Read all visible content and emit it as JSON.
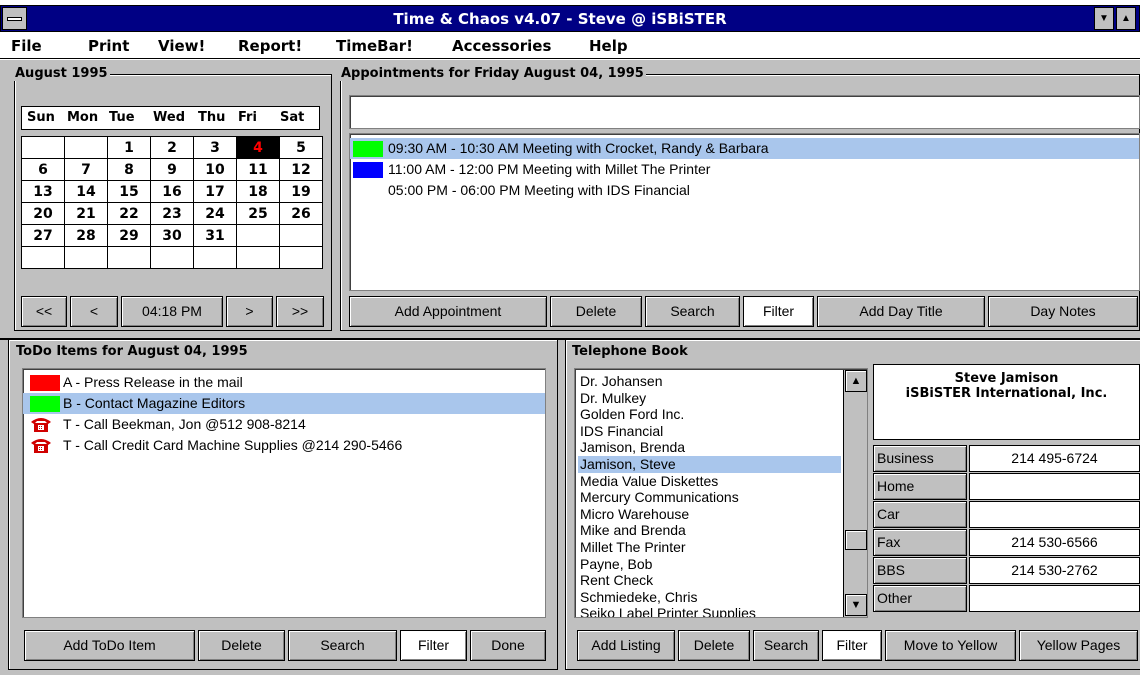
{
  "window": {
    "title": "Time & Chaos v4.07 - Steve @ iSBiSTER"
  },
  "menu": [
    "File",
    "Print",
    "View!",
    "Report!",
    "TimeBar!",
    "Accessories",
    "Help"
  ],
  "calendar": {
    "title": "August 1995",
    "days": [
      "Sun",
      "Mon",
      "Tue",
      "Wed",
      "Thu",
      "Fri",
      "Sat"
    ],
    "weeks": [
      [
        "",
        "",
        "1",
        "2",
        "3",
        "4",
        "5"
      ],
      [
        "6",
        "7",
        "8",
        "9",
        "10",
        "11",
        "12"
      ],
      [
        "13",
        "14",
        "15",
        "16",
        "17",
        "18",
        "19"
      ],
      [
        "20",
        "21",
        "22",
        "23",
        "24",
        "25",
        "26"
      ],
      [
        "27",
        "28",
        "29",
        "30",
        "31",
        "",
        ""
      ],
      [
        "",
        "",
        "",
        "",
        "",
        "",
        ""
      ]
    ],
    "selected_day": "4",
    "nav": {
      "first": "<<",
      "prev": "<",
      "time": "04:18 PM",
      "next": ">",
      "last": ">>"
    }
  },
  "appointments": {
    "title": "Appointments for Friday August 04, 1995",
    "day_title": "",
    "items": [
      {
        "text": "09:30 AM - 10:30 AM Meeting with Crocket, Randy & Barbara",
        "color": "#00ff00",
        "selected": true
      },
      {
        "text": "11:00 AM - 12:00 PM Meeting with Millet The Printer",
        "color": "#0000ff",
        "selected": false
      },
      {
        "text": "05:00 PM - 06:00 PM Meeting with IDS Financial",
        "color": "",
        "selected": false
      }
    ],
    "buttons": {
      "add": "Add Appointment",
      "delete": "Delete",
      "search": "Search",
      "filter": "Filter",
      "day_title": "Add Day Title",
      "day_notes": "Day Notes"
    }
  },
  "todo": {
    "title": "ToDo Items for August 04, 1995",
    "items": [
      {
        "text": "A - Press Release in the mail",
        "icon": "red-swatch",
        "color": "#ff0000"
      },
      {
        "text": "B - Contact Magazine Editors",
        "icon": "green-swatch",
        "color": "#00ff00",
        "selected": true
      },
      {
        "text": "T - Call Beekman, Jon @512 908-8214",
        "icon": "telephone-icon"
      },
      {
        "text": "T - Call Credit Card Machine Supplies @214 290-5466",
        "icon": "telephone-icon"
      }
    ],
    "buttons": {
      "add": "Add ToDo Item",
      "delete": "Delete",
      "search": "Search",
      "filter": "Filter",
      "done": "Done"
    }
  },
  "phonebook": {
    "title": "Telephone Book",
    "entries": [
      "Dr. Johansen",
      "Dr. Mulkey",
      "Golden Ford Inc.",
      "IDS Financial",
      "Jamison, Brenda",
      "Jamison, Steve",
      "Media Value Diskettes",
      "Mercury Communications",
      "Micro Warehouse",
      "Mike and Brenda",
      "Millet The Printer",
      "Payne, Bob",
      "Rent Check",
      "Schmiedeke, Chris",
      "Seiko Label Printer Supplies"
    ],
    "selected": "Jamison, Steve",
    "contact": {
      "name": "Steve Jamison",
      "company": "iSBiSTER International, Inc."
    },
    "fields": [
      {
        "label": "Business",
        "value": "214 495-6724"
      },
      {
        "label": "Home",
        "value": ""
      },
      {
        "label": "Car",
        "value": ""
      },
      {
        "label": "Fax",
        "value": "214 530-6566"
      },
      {
        "label": "BBS",
        "value": "214 530-2762"
      },
      {
        "label": "Other",
        "value": ""
      }
    ],
    "buttons": {
      "add": "Add Listing",
      "delete": "Delete",
      "search": "Search",
      "filter": "Filter",
      "move": "Move to Yellow",
      "yellow": "Yellow Pages"
    }
  },
  "colors": {
    "titlebar": "#000084",
    "panel": "#c0c0c0",
    "highlight": "#a9c6ec",
    "selected_day": "#ff0000"
  }
}
